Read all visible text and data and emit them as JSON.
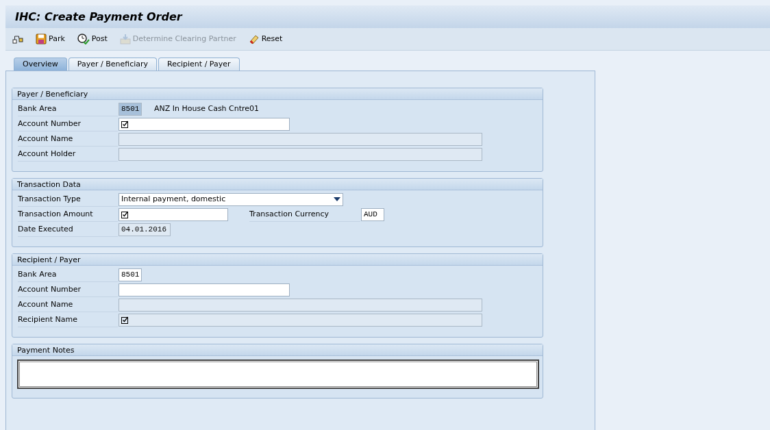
{
  "window": {
    "title": "IHC: Create Payment Order"
  },
  "toolbar": [
    {
      "disabled": false
    },
    {
      "label": "Park",
      "disabled": false
    },
    {
      "label": "Post",
      "disabled": false
    },
    {
      "label": "Determine Clearing Partner",
      "disabled": true
    },
    {
      "label": "Reset",
      "disabled": false
    }
  ],
  "tabs": [
    {
      "label": "Overview",
      "selected": true
    },
    {
      "label": "Payer / Beneficiary",
      "selected": false
    },
    {
      "label": "Recipient / Payer",
      "selected": false
    }
  ],
  "sections": [
    {
      "kind": "form",
      "title": "Payer / Beneficiary",
      "rows": [
        {
          "label": "Bank Area",
          "field": {
            "kind": "code",
            "value": "8501",
            "editable": false,
            "required": false,
            "highlighted": true
          },
          "description": "ANZ In House Cash Cntre01"
        },
        {
          "label": "Account Number",
          "field": {
            "kind": "text",
            "editable": true,
            "required": true
          }
        },
        {
          "label": "Account Name",
          "field": {
            "kind": "display",
            "editable": false,
            "required": false
          }
        },
        {
          "label": "Account Holder",
          "field": {
            "kind": "display",
            "editable": false,
            "required": false
          }
        }
      ]
    },
    {
      "kind": "form",
      "title": "Transaction Data",
      "rows": [
        {
          "label": "Transaction Type",
          "field": {
            "kind": "dropdown",
            "value": "Internal payment, domestic",
            "editable": true,
            "required": false
          }
        },
        {
          "label": "Transaction Amount",
          "field": {
            "kind": "amount",
            "editable": true,
            "required": true
          },
          "extra": {
            "label": "Transaction Currency",
            "field": {
              "kind": "code",
              "value": "AUD",
              "editable": true,
              "required": false
            }
          }
        },
        {
          "label": "Date Executed",
          "field": {
            "kind": "date",
            "value": "04.01.2016",
            "editable": false,
            "required": false
          }
        }
      ]
    },
    {
      "kind": "form",
      "title": "Recipient / Payer",
      "rows": [
        {
          "label": "Bank Area",
          "field": {
            "kind": "code",
            "value": "8501",
            "editable": true,
            "required": false
          }
        },
        {
          "label": "Account Number",
          "field": {
            "kind": "text",
            "editable": true,
            "required": false
          }
        },
        {
          "label": "Account Name",
          "field": {
            "kind": "display",
            "editable": false,
            "required": false
          }
        },
        {
          "label": "Recipient Name",
          "field": {
            "kind": "display",
            "editable": false,
            "required": true
          }
        }
      ]
    },
    {
      "kind": "notes",
      "title": "Payment Notes"
    }
  ]
}
